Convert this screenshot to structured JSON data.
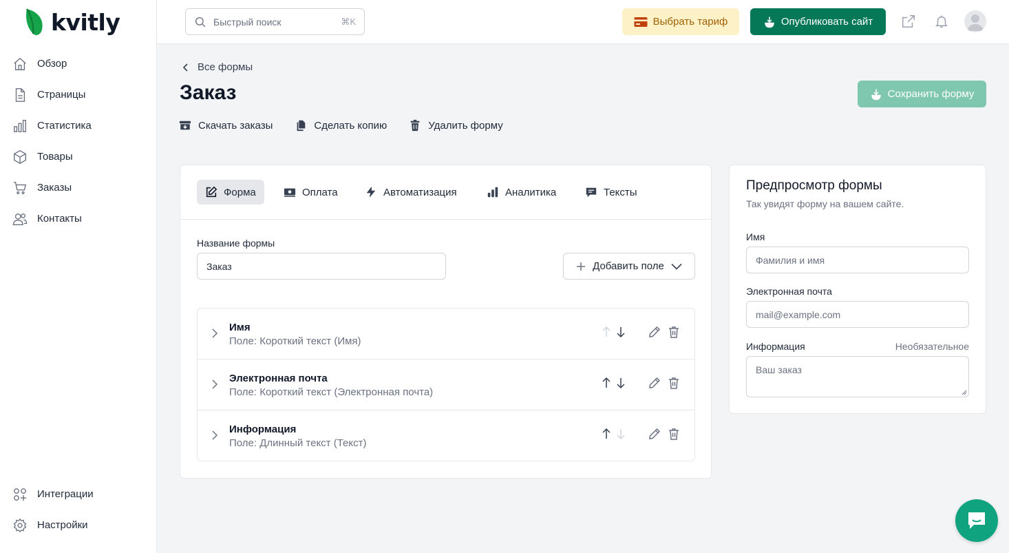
{
  "brand": {
    "name": "kvitly",
    "accent": "#047857"
  },
  "sidebar": {
    "items": [
      {
        "label": "Обзор",
        "icon": "home-icon"
      },
      {
        "label": "Страницы",
        "icon": "page-icon"
      },
      {
        "label": "Статистика",
        "icon": "chart-icon"
      },
      {
        "label": "Товары",
        "icon": "box-icon"
      },
      {
        "label": "Заказы",
        "icon": "cart-icon"
      },
      {
        "label": "Контакты",
        "icon": "users-icon"
      }
    ],
    "bottom": [
      {
        "label": "Интеграции",
        "icon": "integrations-icon"
      },
      {
        "label": "Настройки",
        "icon": "gear-icon"
      }
    ]
  },
  "topbar": {
    "search_placeholder": "Быстрый поиск",
    "search_shortcut": "⌘K",
    "tariff_label": "Выбрать тариф",
    "publish_label": "Опубликовать сайт"
  },
  "page": {
    "back_label": "Все формы",
    "title": "Заказ",
    "save_label": "Сохранить форму",
    "actions": {
      "download": "Скачать заказы",
      "copy": "Сделать копию",
      "delete": "Удалить форму"
    }
  },
  "form": {
    "tabs": [
      {
        "label": "Форма",
        "icon": "edit-icon",
        "active": true
      },
      {
        "label": "Оплата",
        "icon": "payment-icon",
        "active": false
      },
      {
        "label": "Автоматизация",
        "icon": "bolt-icon",
        "active": false
      },
      {
        "label": "Аналитика",
        "icon": "bar-chart-icon",
        "active": false
      },
      {
        "label": "Тексты",
        "icon": "message-icon",
        "active": false
      }
    ],
    "name_label": "Название формы",
    "name_value": "Заказ",
    "add_field_label": "Добавить поле",
    "fields": [
      {
        "name": "Имя",
        "desc": "Поле: Короткий текст (Имя)"
      },
      {
        "name": "Электронная почта",
        "desc": "Поле: Короткий текст (Электронная почта)"
      },
      {
        "name": "Информация",
        "desc": "Поле: Длинный текст (Текст)"
      }
    ]
  },
  "preview": {
    "title": "Предпросмотр формы",
    "subtitle": "Так увидят форму на вашем сайте.",
    "name_label": "Имя",
    "name_placeholder": "Фамилия и имя",
    "email_label": "Электронная почта",
    "email_placeholder": "mail@example.com",
    "info_label": "Информация",
    "info_optional": "Необязательное",
    "info_placeholder": "Ваш заказ"
  }
}
